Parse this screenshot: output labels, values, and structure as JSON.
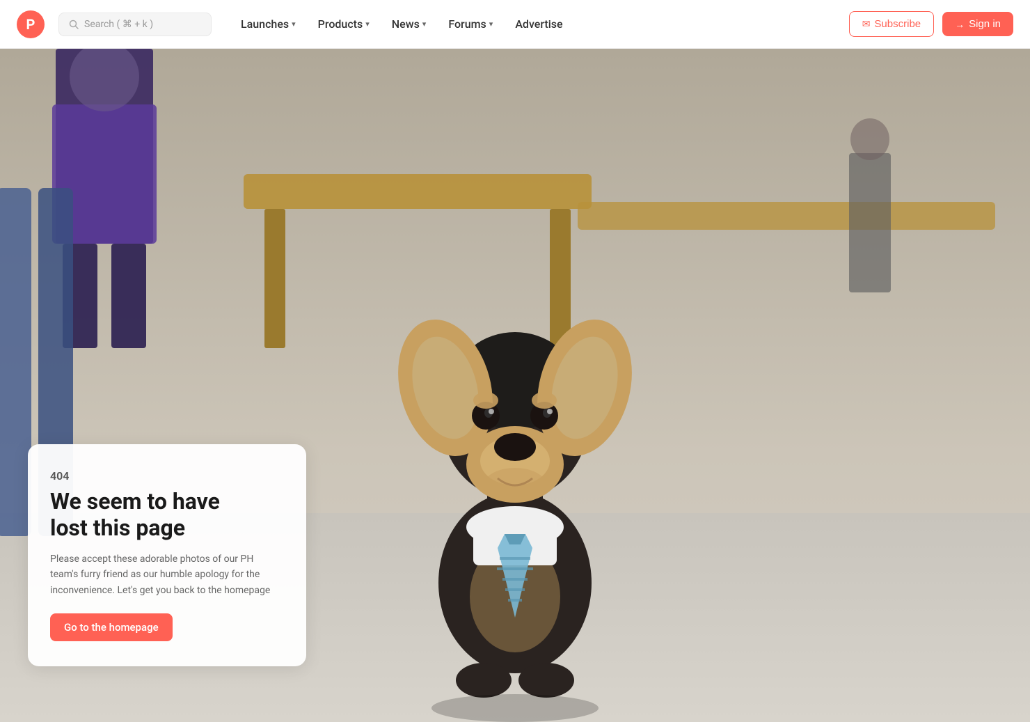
{
  "navbar": {
    "logo_letter": "P",
    "search_placeholder": "Search ( ⌘ + k )",
    "nav_items": [
      {
        "label": "Launches",
        "has_dropdown": true
      },
      {
        "label": "Products",
        "has_dropdown": true
      },
      {
        "label": "News",
        "has_dropdown": true
      },
      {
        "label": "Forums",
        "has_dropdown": true
      },
      {
        "label": "Advertise",
        "has_dropdown": false
      }
    ],
    "subscribe_label": "Subscribe",
    "signin_label": "Sign in"
  },
  "error_page": {
    "code": "404",
    "title_line1": "We seem to have",
    "title_line2": "lost this page",
    "description": "Please accept these adorable photos of our PH team's furry friend as our humble apology for the inconvenience. Let's get you back to the homepage",
    "cta_label": "Go to the homepage"
  },
  "colors": {
    "brand": "#ff6154",
    "text_dark": "#1a1a1a",
    "text_medium": "#555",
    "text_light": "#666"
  }
}
